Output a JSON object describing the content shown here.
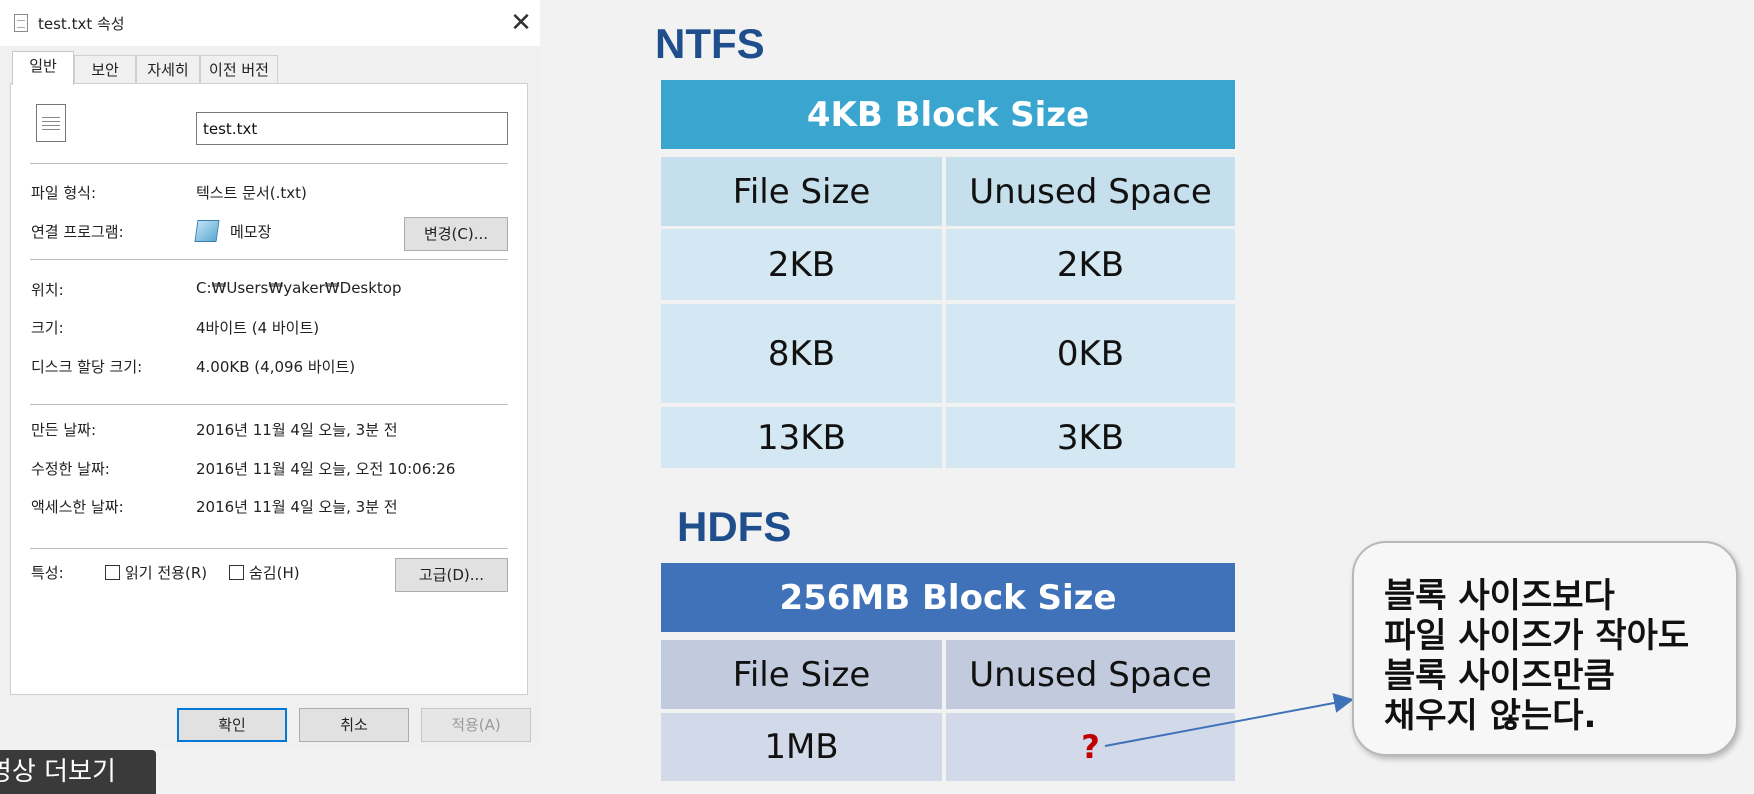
{
  "dialog": {
    "title": "test.txt 속성",
    "close_glyph": "✕",
    "tabs": [
      "일반",
      "보안",
      "자세히",
      "이전 버전"
    ],
    "filename": "test.txt",
    "file_type_label": "파일 형식:",
    "file_type_value": "텍스트 문서(.txt)",
    "open_with_label": "연결 프로그램:",
    "open_with_value": "메모장",
    "change_button": "변경(C)...",
    "location_label": "위치:",
    "location_value": "C:₩Users₩yaker₩Desktop",
    "size_label": "크기:",
    "size_value": "4바이트 (4 바이트)",
    "size_on_disk_label": "디스크 할당 크기:",
    "size_on_disk_value": "4.00KB (4,096 바이트)",
    "created_label": "만든 날짜:",
    "created_value": "2016년 11월 4일 오늘, 3분 전",
    "modified_label": "수정한 날짜:",
    "modified_value": "2016년 11월 4일 오늘, 오전 10:06:26",
    "accessed_label": "액세스한 날짜:",
    "accessed_value": "2016년 11월 4일 오늘, 3분 전",
    "attributes_label": "특성:",
    "readonly_label": "읽기 전용(R)",
    "hidden_label": "숨김(H)",
    "advanced_button": "고급(D)...",
    "ok_button": "확인",
    "cancel_button": "취소",
    "apply_button": "적용(A)"
  },
  "overlay": {
    "more_videos": "영상 더보기"
  },
  "ntfs": {
    "title": "NTFS",
    "block_size": "4KB Block Size",
    "col_file_size": "File Size",
    "col_unused": "Unused Space",
    "rows": [
      {
        "file_size": "2KB",
        "unused": "2KB"
      },
      {
        "file_size": "8KB",
        "unused": "0KB"
      },
      {
        "file_size": "13KB",
        "unused": "3KB"
      }
    ]
  },
  "hdfs": {
    "title": "HDFS",
    "block_size": "256MB Block Size",
    "col_file_size": "File Size",
    "col_unused": "Unused Space",
    "rows": [
      {
        "file_size": "1MB",
        "unused": "?"
      }
    ]
  },
  "callout": {
    "lines": [
      "블록 사이즈보다",
      "파일 사이즈가 작아도",
      "블록 사이즈만큼",
      "채우지 않는다."
    ]
  },
  "colors": {
    "ntfs_header": "#3aa6cf",
    "hdfs_header": "#3f72b8",
    "title_blue": "#1f4e8c",
    "question_mark": "#c00000"
  }
}
